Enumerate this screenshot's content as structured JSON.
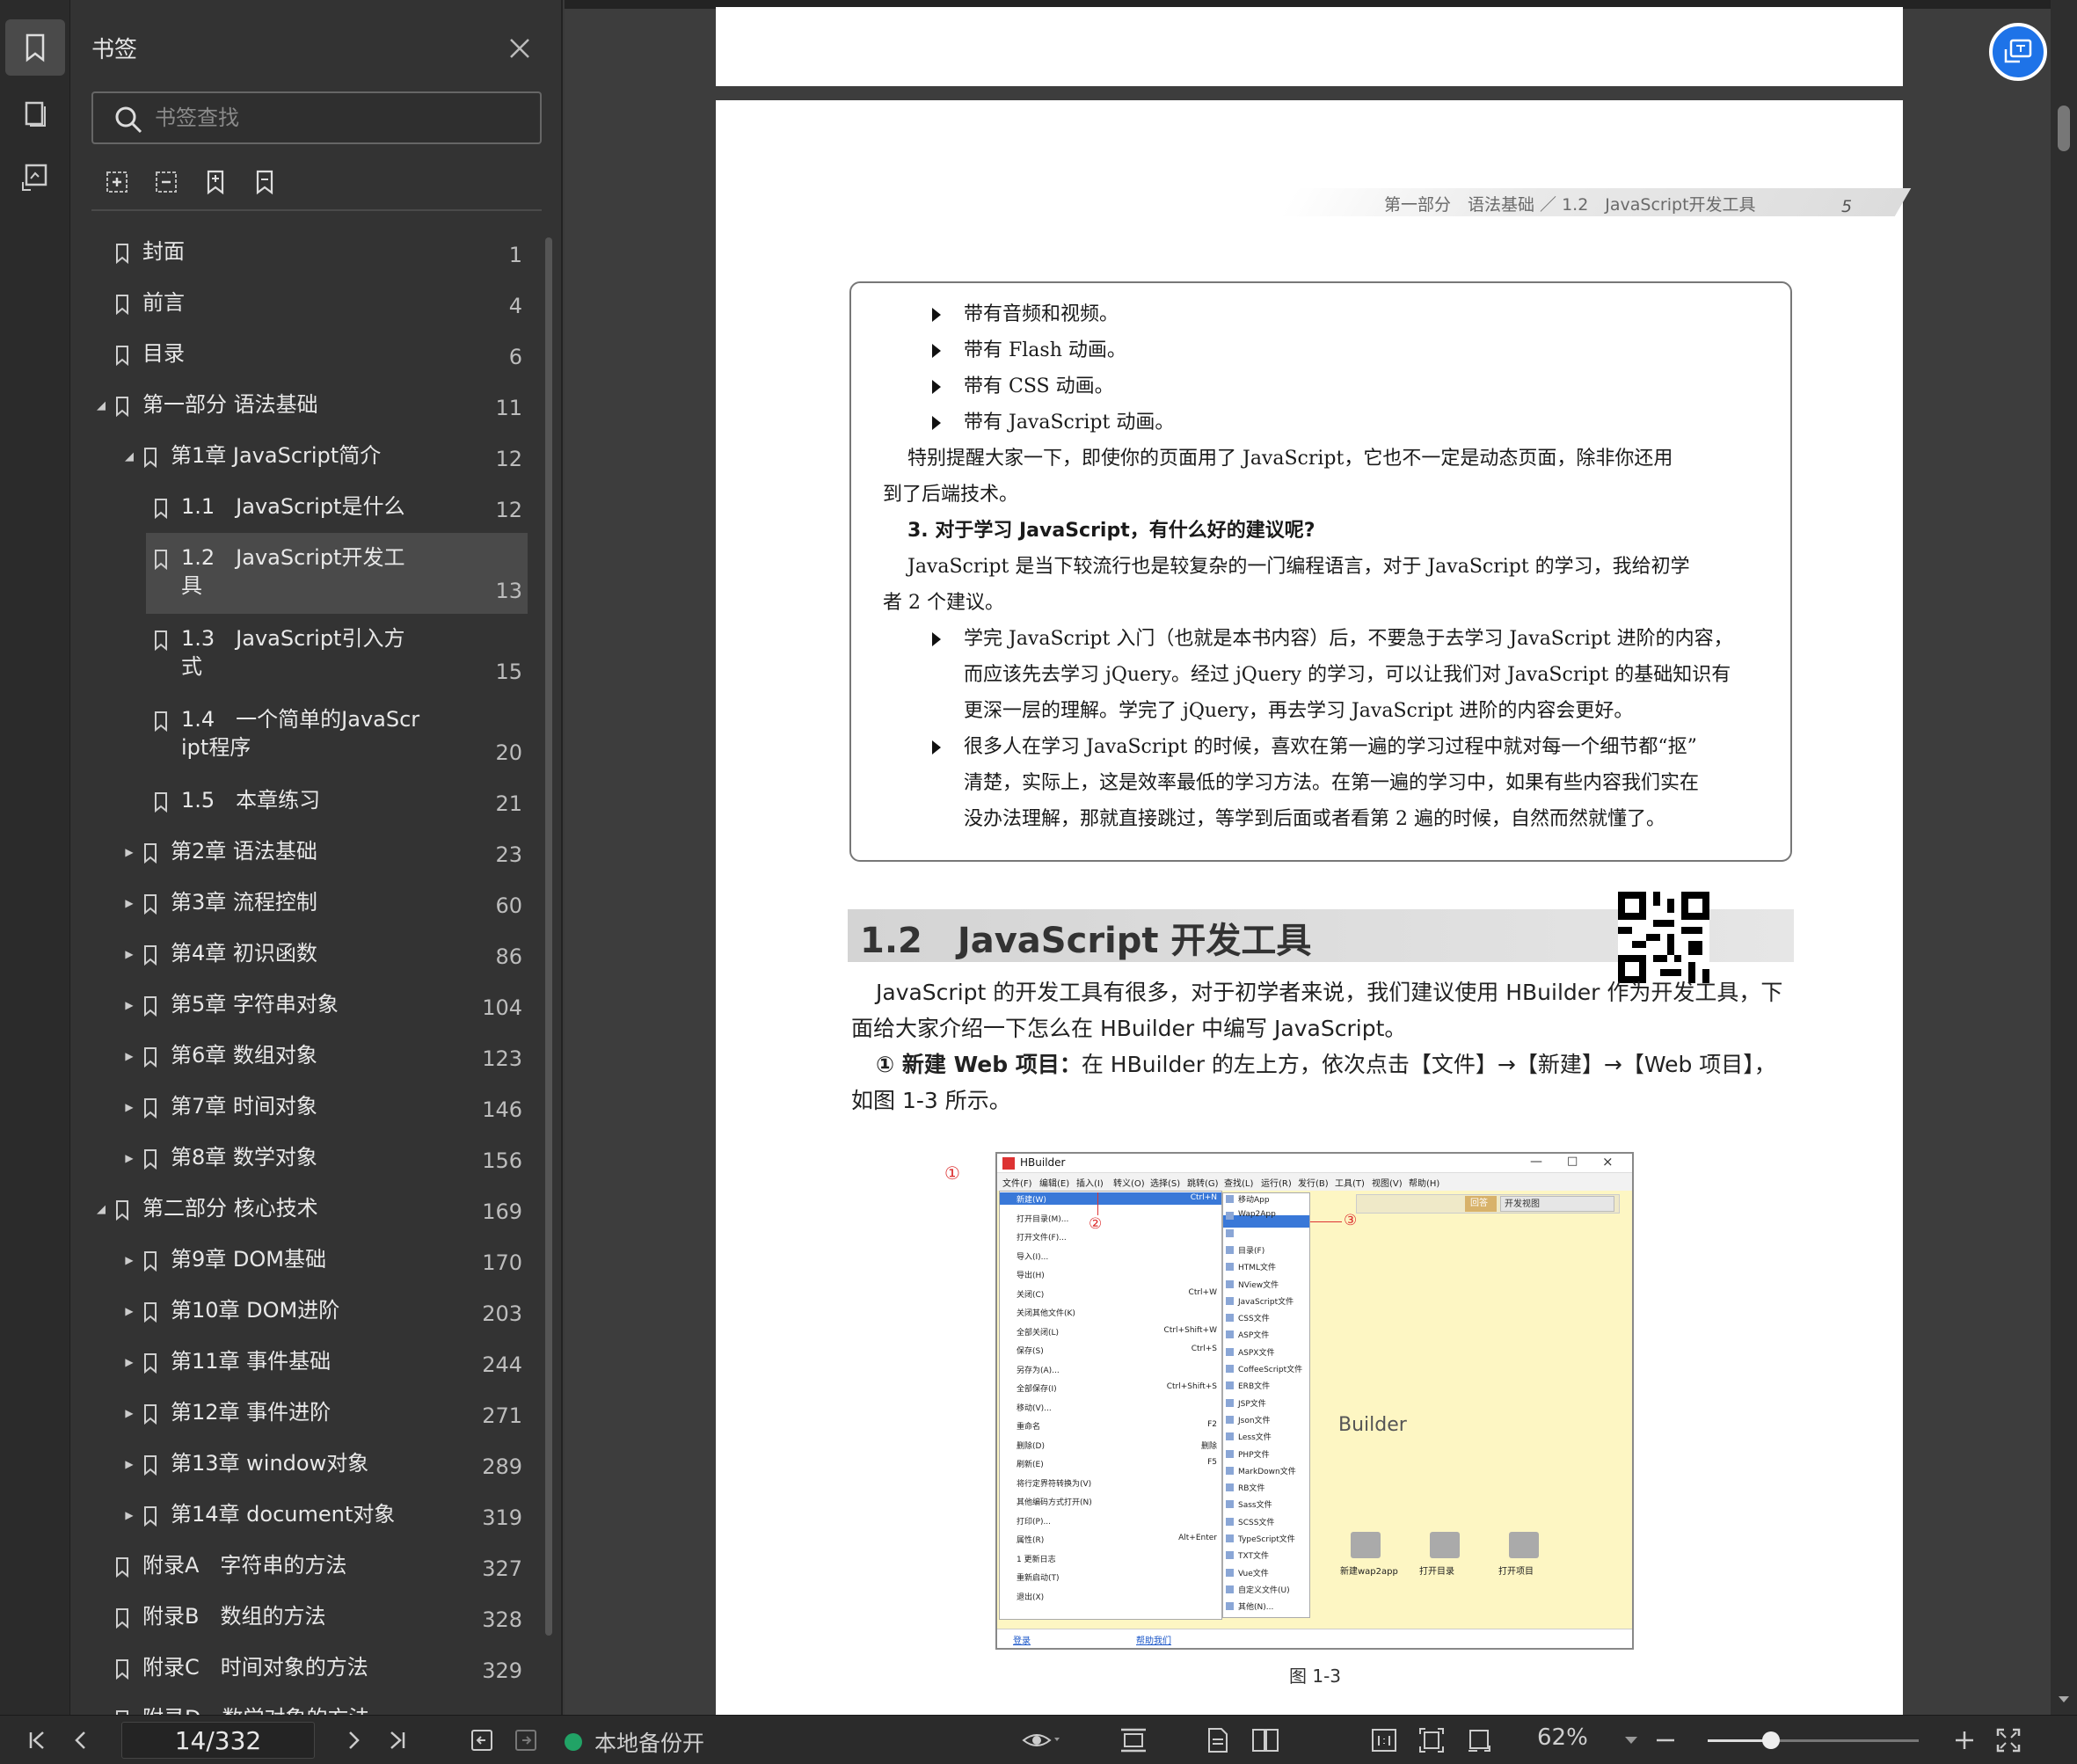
{
  "panel": {
    "title": "书签",
    "search_placeholder": "书签查找"
  },
  "bookmarks": [
    {
      "label": "封面",
      "page": "1",
      "level": 0,
      "toggle": "none"
    },
    {
      "label": "前言",
      "page": "4",
      "level": 0,
      "toggle": "none"
    },
    {
      "label": "目录",
      "page": "6",
      "level": 0,
      "toggle": "none"
    },
    {
      "label": "第一部分 语法基础",
      "page": "11",
      "level": 0,
      "toggle": "expanded"
    },
    {
      "label": "第1章 JavaScript简介",
      "page": "12",
      "level": 1,
      "toggle": "expanded"
    },
    {
      "label": "1.1　JavaScript是什么",
      "page": "12",
      "level": 2,
      "toggle": "none"
    },
    {
      "label": "1.2　JavaScript开发工",
      "label2": "具",
      "page": "13",
      "level": 2,
      "toggle": "none",
      "selected": true
    },
    {
      "label": "1.3　JavaScript引入方",
      "label2": "式",
      "page": "15",
      "level": 2,
      "toggle": "none"
    },
    {
      "label": "1.4　一个简单的JavaScr",
      "label2": "ipt程序",
      "page": "20",
      "level": 2,
      "toggle": "none"
    },
    {
      "label": "1.5　本章练习",
      "page": "21",
      "level": 2,
      "toggle": "none"
    },
    {
      "label": "第2章 语法基础",
      "page": "23",
      "level": 1,
      "toggle": "collapsed"
    },
    {
      "label": "第3章 流程控制",
      "page": "60",
      "level": 1,
      "toggle": "collapsed"
    },
    {
      "label": "第4章 初识函数",
      "page": "86",
      "level": 1,
      "toggle": "collapsed"
    },
    {
      "label": "第5章 字符串对象",
      "page": "104",
      "level": 1,
      "toggle": "collapsed"
    },
    {
      "label": "第6章 数组对象",
      "page": "123",
      "level": 1,
      "toggle": "collapsed"
    },
    {
      "label": "第7章 时间对象",
      "page": "146",
      "level": 1,
      "toggle": "collapsed"
    },
    {
      "label": "第8章 数学对象",
      "page": "156",
      "level": 1,
      "toggle": "collapsed"
    },
    {
      "label": "第二部分 核心技术",
      "page": "169",
      "level": 0,
      "toggle": "expanded"
    },
    {
      "label": "第9章 DOM基础",
      "page": "170",
      "level": 1,
      "toggle": "collapsed"
    },
    {
      "label": "第10章 DOM进阶",
      "page": "203",
      "level": 1,
      "toggle": "collapsed"
    },
    {
      "label": "第11章 事件基础",
      "page": "244",
      "level": 1,
      "toggle": "collapsed"
    },
    {
      "label": "第12章 事件进阶",
      "page": "271",
      "level": 1,
      "toggle": "collapsed"
    },
    {
      "label": "第13章 window对象",
      "page": "289",
      "level": 1,
      "toggle": "collapsed"
    },
    {
      "label": "第14章 document对象",
      "page": "319",
      "level": 1,
      "toggle": "collapsed"
    },
    {
      "label": "附录A　字符串的方法",
      "page": "327",
      "level": 0,
      "toggle": "none"
    },
    {
      "label": "附录B　数组的方法",
      "page": "328",
      "level": 0,
      "toggle": "none"
    },
    {
      "label": "附录C　时间对象的方法",
      "page": "329",
      "level": 0,
      "toggle": "none"
    },
    {
      "label": "附录D　数学对象的方法",
      "page": "",
      "level": 0,
      "toggle": "none"
    }
  ],
  "document": {
    "running_header": "第一部分　语法基础 ／ 1.2　JavaScript开发工具",
    "page_number": "5",
    "box": {
      "bullets1": [
        "带有音频和视频。",
        "带有 Flash 动画。",
        "带有 CSS 动画。",
        "带有 JavaScript 动画。"
      ],
      "para1_line1": "特别提醒大家一下，即使你的页面用了 JavaScript，它也不一定是动态页面，除非你还用",
      "para1_line2": "到了后端技术。",
      "heading": "3.  对于学习 JavaScript，有什么好的建议呢?",
      "para2_line1": "JavaScript 是当下较流行也是较复杂的一门编程语言，对于 JavaScript 的学习，我给初学",
      "para2_line2": "者 2 个建议。",
      "bullet_a_1": "学完 JavaScript 入门（也就是本书内容）后，不要急于去学习 JavaScript 进阶的内容，",
      "bullet_a_2": "而应该先去学习 jQuery。经过 jQuery 的学习，可以让我们对 JavaScript 的基础知识有",
      "bullet_a_3": "更深一层的理解。学完了 jQuery，再去学习 JavaScript 进阶的内容会更好。",
      "bullet_b_1": "很多人在学习 JavaScript 的时候，喜欢在第一遍的学习过程中就对每一个细节都“抠”",
      "bullet_b_2": "清楚，实际上，这是效率最低的学习方法。在第一遍的学习中，如果有些内容我们实在",
      "bullet_b_3": "没办法理解，那就直接跳过，等学到后面或者看第 2 遍的时候，自然而然就懂了。"
    },
    "section_title": "1.2　JavaScript 开发工具",
    "body1_line1": "JavaScript 的开发工具有很多，对于初学者来说，我们建议使用 HBuilder 作为开发工具，下",
    "body1_line2": "面给大家介绍一下怎么在 HBuilder 中编写 JavaScript。",
    "step1_bold": "① 新建 Web 项目：",
    "step1_rest": "在 HBuilder 的左上方，依次点击【文件】→【新建】→【Web 项目】，",
    "step1_line2": "如图 1-3 所示。",
    "figure": {
      "caption": "图 1-3",
      "app_title": "HBuilder",
      "menubar": [
        "文件(F)",
        "编辑(E)",
        "插入(I)",
        "转义(O)",
        "选择(S)",
        "跳转(G)",
        "查找(L)",
        "运行(R)",
        "发行(B)",
        "工具(T)",
        "视图(V)",
        "帮助(H)"
      ],
      "file_menu": [
        {
          "label": "新建(W)",
          "shortcut": "Ctrl+N"
        },
        {
          "label": "打开目录(M)...",
          "shortcut": ""
        },
        {
          "label": "打开文件(F)...",
          "shortcut": ""
        },
        {
          "label": "导入(I)...",
          "shortcut": ""
        },
        {
          "label": "导出(H)",
          "shortcut": ""
        },
        {
          "label": "关闭(C)",
          "shortcut": "Ctrl+W"
        },
        {
          "label": "关闭其他文件(K)",
          "shortcut": ""
        },
        {
          "label": "全部关闭(L)",
          "shortcut": "Ctrl+Shift+W"
        },
        {
          "label": "保存(S)",
          "shortcut": "Ctrl+S"
        },
        {
          "label": "另存为(A)...",
          "shortcut": ""
        },
        {
          "label": "全部保存(I)",
          "shortcut": "Ctrl+Shift+S"
        },
        {
          "label": "移动(V)...",
          "shortcut": ""
        },
        {
          "label": "重命名",
          "shortcut": "F2"
        },
        {
          "label": "删除(D)",
          "shortcut": "删除"
        },
        {
          "label": "刷新(E)",
          "shortcut": "F5"
        },
        {
          "label": "将行定界符转换为(V)",
          "shortcut": ""
        },
        {
          "label": "其他编码方式打开(N)",
          "shortcut": ""
        },
        {
          "label": "打印(P)...",
          "shortcut": ""
        },
        {
          "label": "属性(R)",
          "shortcut": "Alt+Enter"
        },
        {
          "label": "1 更新日志",
          "shortcut": ""
        },
        {
          "label": "重新启动(T)",
          "shortcut": ""
        },
        {
          "label": "退出(X)",
          "shortcut": ""
        }
      ],
      "new_menu": [
        "移动App",
        "Wap2App",
        "Web项目",
        "目录(F)",
        "HTML文件",
        "NView文件",
        "JavaScript文件",
        "CSS文件",
        "ASP文件",
        "ASPX文件",
        "CoffeeScript文件",
        "ERB文件",
        "JSP文件",
        "Json文件",
        "Less文件",
        "PHP文件",
        "MarkDown文件",
        "RB文件",
        "Sass文件",
        "SCSS文件",
        "TypeScript文件",
        "TXT文件",
        "Vue文件",
        "自定义文件(U)",
        "其他(N)..."
      ],
      "toolbar_btn": "开发视图",
      "toolbar_btn2": "回答",
      "logo_text": "Builder",
      "tiles": [
        "新建wap2app",
        "打开目录",
        "打开项目"
      ],
      "footer_login": "登录",
      "footer_help": "帮助我们",
      "marker1": "①",
      "marker2": "②",
      "marker3": "③"
    }
  },
  "statusbar": {
    "page_indicator": "14/332",
    "backup_label": "本地备份开",
    "zoom": "62%",
    "zoom_fraction": 0.3
  },
  "colors": {
    "accent": "#1e73e8",
    "backup": "#21a366",
    "annotation": "#d33333",
    "selected": "#4a4a4a"
  }
}
